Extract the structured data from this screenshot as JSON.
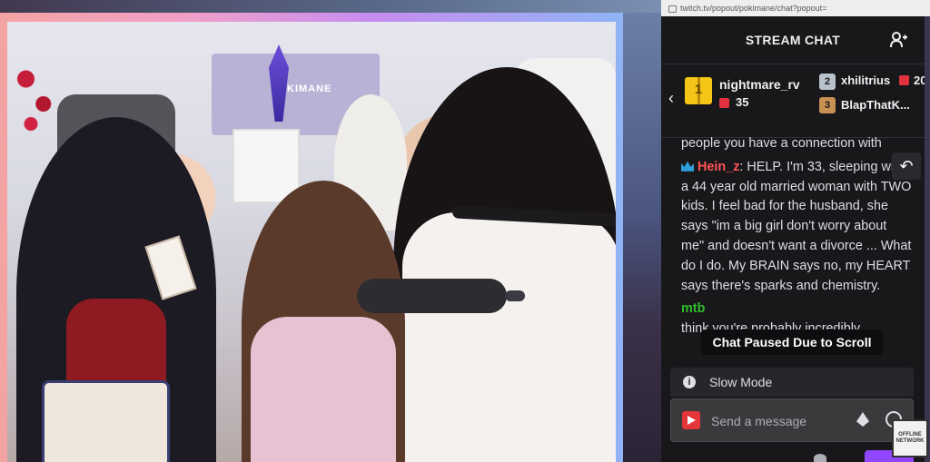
{
  "browser": {
    "url": "twitch.tv/popout/pokimane/chat?popout="
  },
  "video": {
    "poster_text": "KIMANE"
  },
  "chat": {
    "header_title": "STREAM CHAT",
    "gifters": {
      "top": {
        "rank": "1",
        "name": "nightmare_rv",
        "count": "35"
      },
      "second": {
        "rank": "2",
        "name": "xhilitrius",
        "count": "20"
      },
      "third": {
        "rank": "3",
        "name": "BlapThatK..."
      }
    },
    "messages": [
      {
        "user": "",
        "text": "people you have a connection with"
      },
      {
        "user": "Hein_z",
        "text": ": HELP. I'm 33, sleeping with a 44 year old married woman with TWO kids. I feel bad for the husband, she says \"im a big girl don't worry about me\" and doesn't want a divorce ... What do I do. My BRAIN says no, my HEART says there's sparks and chemistry."
      },
      {
        "user": "mtb",
        "text": "think you're probably incredibly"
      }
    ],
    "paused_text": "Chat Paused Due to Scroll",
    "slow_mode_label": "Slow Mode",
    "input_placeholder": "Send a message"
  },
  "overlay": {
    "offline_badge": "OFFLINE NETWORK"
  },
  "colors": {
    "chat_bg": "#18181b",
    "moderator_name": "#ff5353",
    "viewer_name": "#2fbf2a",
    "twitch_purple": "#9147ff"
  }
}
